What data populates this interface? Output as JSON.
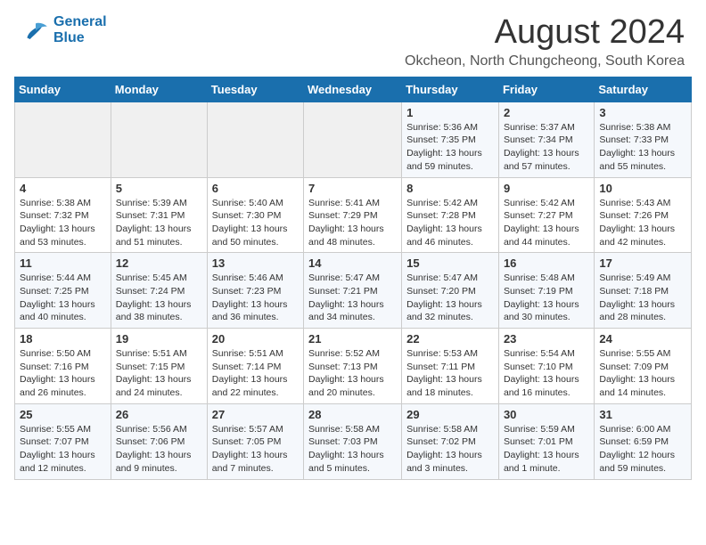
{
  "header": {
    "logo_line1": "General",
    "logo_line2": "Blue",
    "main_title": "August 2024",
    "subtitle": "Okcheon, North Chungcheong, South Korea"
  },
  "days_of_week": [
    "Sunday",
    "Monday",
    "Tuesday",
    "Wednesday",
    "Thursday",
    "Friday",
    "Saturday"
  ],
  "weeks": [
    [
      {
        "day": "",
        "info": ""
      },
      {
        "day": "",
        "info": ""
      },
      {
        "day": "",
        "info": ""
      },
      {
        "day": "",
        "info": ""
      },
      {
        "day": "1",
        "info": "Sunrise: 5:36 AM\nSunset: 7:35 PM\nDaylight: 13 hours\nand 59 minutes."
      },
      {
        "day": "2",
        "info": "Sunrise: 5:37 AM\nSunset: 7:34 PM\nDaylight: 13 hours\nand 57 minutes."
      },
      {
        "day": "3",
        "info": "Sunrise: 5:38 AM\nSunset: 7:33 PM\nDaylight: 13 hours\nand 55 minutes."
      }
    ],
    [
      {
        "day": "4",
        "info": "Sunrise: 5:38 AM\nSunset: 7:32 PM\nDaylight: 13 hours\nand 53 minutes."
      },
      {
        "day": "5",
        "info": "Sunrise: 5:39 AM\nSunset: 7:31 PM\nDaylight: 13 hours\nand 51 minutes."
      },
      {
        "day": "6",
        "info": "Sunrise: 5:40 AM\nSunset: 7:30 PM\nDaylight: 13 hours\nand 50 minutes."
      },
      {
        "day": "7",
        "info": "Sunrise: 5:41 AM\nSunset: 7:29 PM\nDaylight: 13 hours\nand 48 minutes."
      },
      {
        "day": "8",
        "info": "Sunrise: 5:42 AM\nSunset: 7:28 PM\nDaylight: 13 hours\nand 46 minutes."
      },
      {
        "day": "9",
        "info": "Sunrise: 5:42 AM\nSunset: 7:27 PM\nDaylight: 13 hours\nand 44 minutes."
      },
      {
        "day": "10",
        "info": "Sunrise: 5:43 AM\nSunset: 7:26 PM\nDaylight: 13 hours\nand 42 minutes."
      }
    ],
    [
      {
        "day": "11",
        "info": "Sunrise: 5:44 AM\nSunset: 7:25 PM\nDaylight: 13 hours\nand 40 minutes."
      },
      {
        "day": "12",
        "info": "Sunrise: 5:45 AM\nSunset: 7:24 PM\nDaylight: 13 hours\nand 38 minutes."
      },
      {
        "day": "13",
        "info": "Sunrise: 5:46 AM\nSunset: 7:23 PM\nDaylight: 13 hours\nand 36 minutes."
      },
      {
        "day": "14",
        "info": "Sunrise: 5:47 AM\nSunset: 7:21 PM\nDaylight: 13 hours\nand 34 minutes."
      },
      {
        "day": "15",
        "info": "Sunrise: 5:47 AM\nSunset: 7:20 PM\nDaylight: 13 hours\nand 32 minutes."
      },
      {
        "day": "16",
        "info": "Sunrise: 5:48 AM\nSunset: 7:19 PM\nDaylight: 13 hours\nand 30 minutes."
      },
      {
        "day": "17",
        "info": "Sunrise: 5:49 AM\nSunset: 7:18 PM\nDaylight: 13 hours\nand 28 minutes."
      }
    ],
    [
      {
        "day": "18",
        "info": "Sunrise: 5:50 AM\nSunset: 7:16 PM\nDaylight: 13 hours\nand 26 minutes."
      },
      {
        "day": "19",
        "info": "Sunrise: 5:51 AM\nSunset: 7:15 PM\nDaylight: 13 hours\nand 24 minutes."
      },
      {
        "day": "20",
        "info": "Sunrise: 5:51 AM\nSunset: 7:14 PM\nDaylight: 13 hours\nand 22 minutes."
      },
      {
        "day": "21",
        "info": "Sunrise: 5:52 AM\nSunset: 7:13 PM\nDaylight: 13 hours\nand 20 minutes."
      },
      {
        "day": "22",
        "info": "Sunrise: 5:53 AM\nSunset: 7:11 PM\nDaylight: 13 hours\nand 18 minutes."
      },
      {
        "day": "23",
        "info": "Sunrise: 5:54 AM\nSunset: 7:10 PM\nDaylight: 13 hours\nand 16 minutes."
      },
      {
        "day": "24",
        "info": "Sunrise: 5:55 AM\nSunset: 7:09 PM\nDaylight: 13 hours\nand 14 minutes."
      }
    ],
    [
      {
        "day": "25",
        "info": "Sunrise: 5:55 AM\nSunset: 7:07 PM\nDaylight: 13 hours\nand 12 minutes."
      },
      {
        "day": "26",
        "info": "Sunrise: 5:56 AM\nSunset: 7:06 PM\nDaylight: 13 hours\nand 9 minutes."
      },
      {
        "day": "27",
        "info": "Sunrise: 5:57 AM\nSunset: 7:05 PM\nDaylight: 13 hours\nand 7 minutes."
      },
      {
        "day": "28",
        "info": "Sunrise: 5:58 AM\nSunset: 7:03 PM\nDaylight: 13 hours\nand 5 minutes."
      },
      {
        "day": "29",
        "info": "Sunrise: 5:58 AM\nSunset: 7:02 PM\nDaylight: 13 hours\nand 3 minutes."
      },
      {
        "day": "30",
        "info": "Sunrise: 5:59 AM\nSunset: 7:01 PM\nDaylight: 13 hours\nand 1 minute."
      },
      {
        "day": "31",
        "info": "Sunrise: 6:00 AM\nSunset: 6:59 PM\nDaylight: 12 hours\nand 59 minutes."
      }
    ]
  ]
}
